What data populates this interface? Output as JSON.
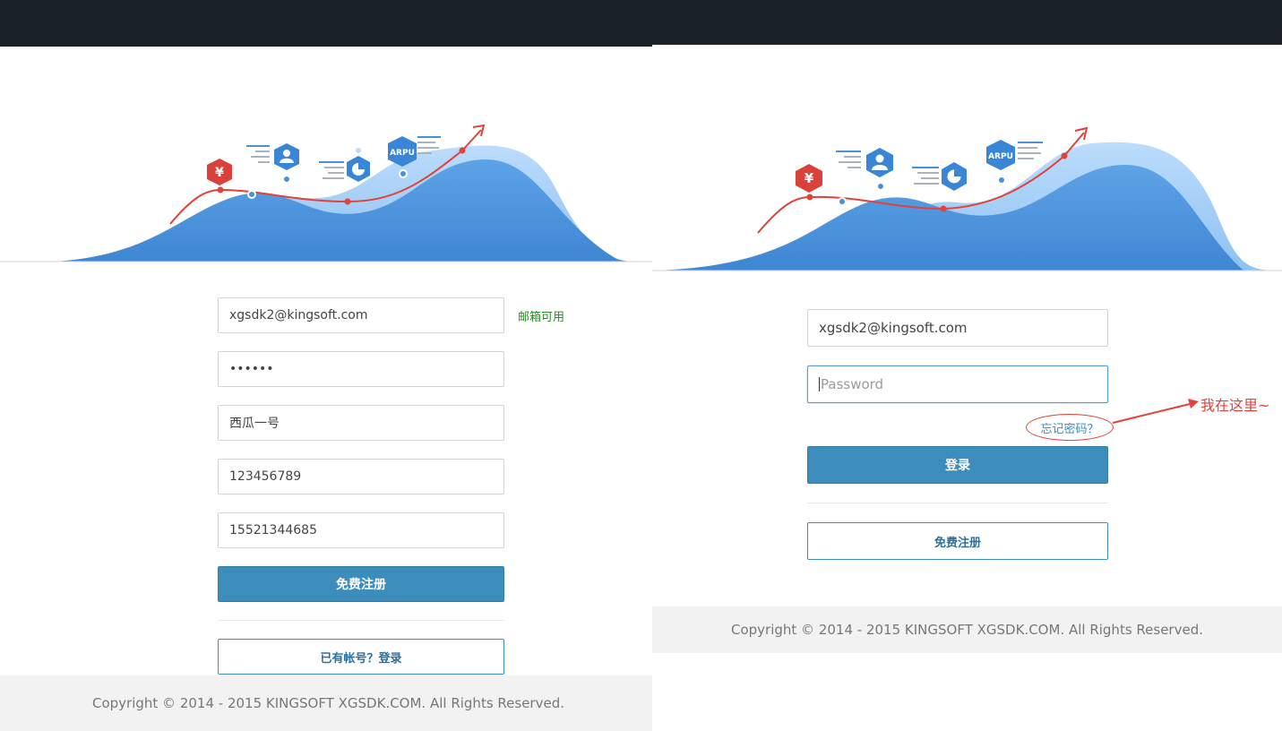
{
  "icons": {
    "yen": "¥",
    "user": "user-icon",
    "pie": "pie-icon",
    "arpu": "ARPU"
  },
  "colors": {
    "topbar": "#1b2227",
    "primary": "#3c8dbc",
    "hill_dark": "#4a90d9",
    "hill_light": "#a8cff5",
    "trend": "#e0433b",
    "success_hint": "#2a8a2a"
  },
  "register": {
    "email_value": "xgsdk2@kingsoft.com",
    "email_hint": "邮箱可用",
    "password_value": "••••••",
    "nickname_value": "西瓜一号",
    "qq_value": "123456789",
    "phone_value": "15521344685",
    "submit_label": "免费注册",
    "login_link_label": "已有帐号？登录",
    "footer": "Copyright © 2014 - 2015 KINGSOFT XGSDK.COM. All Rights Reserved."
  },
  "login": {
    "email_value": "xgsdk2@kingsoft.com",
    "password_placeholder": "Password",
    "forgot_label": "忘记密码？",
    "annotation": "我在这里~",
    "submit_label": "登录",
    "register_label": "免费注册",
    "footer": "Copyright © 2014 - 2015 KINGSOFT XGSDK.COM. All Rights Reserved."
  }
}
